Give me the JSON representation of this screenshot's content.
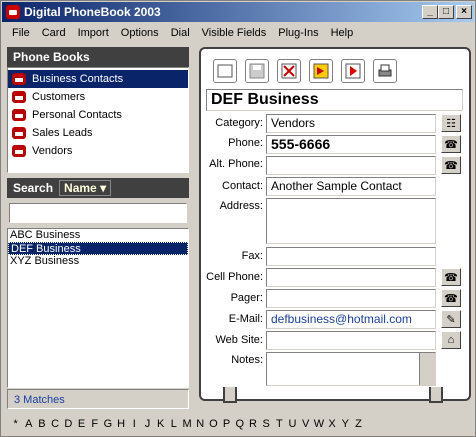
{
  "window": {
    "title": "Digital PhoneBook 2003"
  },
  "menu": [
    "File",
    "Card",
    "Import",
    "Options",
    "Dial",
    "Visible Fields",
    "Plug-Ins",
    "Help"
  ],
  "phonebooks": {
    "header": "Phone Books",
    "items": [
      "Business Contacts",
      "Customers",
      "Personal Contacts",
      "Sales Leads",
      "Vendors"
    ]
  },
  "search": {
    "label": "Search",
    "field": "Name",
    "value": ""
  },
  "results": {
    "items": [
      "ABC Business",
      "DEF Business",
      "XYZ Business"
    ],
    "status": "3 Matches"
  },
  "card": {
    "name": "DEF Business",
    "fields": {
      "category": {
        "label": "Category:",
        "value": "Vendors"
      },
      "phone": {
        "label": "Phone:",
        "value": "555-6666"
      },
      "alt_phone": {
        "label": "Alt. Phone:",
        "value": ""
      },
      "contact": {
        "label": "Contact:",
        "value": "Another Sample Contact"
      },
      "address": {
        "label": "Address:",
        "value": ""
      },
      "fax": {
        "label": "Fax:",
        "value": ""
      },
      "cell_phone": {
        "label": "Cell Phone:",
        "value": ""
      },
      "pager": {
        "label": "Pager:",
        "value": ""
      },
      "email": {
        "label": "E-Mail:",
        "value": "defbusiness@hotmail.com"
      },
      "website": {
        "label": "Web Site:",
        "value": ""
      },
      "notes": {
        "label": "Notes:",
        "value": ""
      }
    }
  },
  "alphabet": [
    "*",
    "A",
    "B",
    "C",
    "D",
    "E",
    "F",
    "G",
    "H",
    "I",
    "J",
    "K",
    "L",
    "M",
    "N",
    "O",
    "P",
    "Q",
    "R",
    "S",
    "T",
    "U",
    "V",
    "W",
    "X",
    "Y",
    "Z"
  ],
  "colors": {
    "title_dark": "#0a246a",
    "panel_header": "#404040",
    "email": "#1a3fa0"
  }
}
